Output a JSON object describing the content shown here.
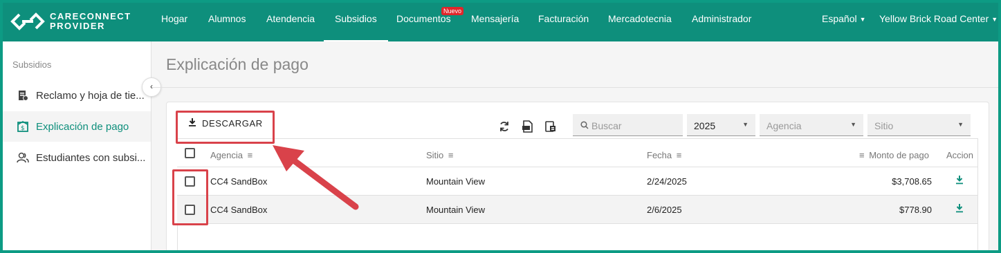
{
  "brand": {
    "line1": "CARECONNECT",
    "line2": "PROVIDER"
  },
  "nav": {
    "items": [
      {
        "label": "Hogar"
      },
      {
        "label": "Alumnos"
      },
      {
        "label": "Atendencia"
      },
      {
        "label": "Subsidios"
      },
      {
        "label": "Documentos"
      },
      {
        "label": "Mensajería"
      },
      {
        "label": "Facturación"
      },
      {
        "label": "Mercadotecnia"
      },
      {
        "label": "Administrador"
      }
    ],
    "badge": "Nuevo",
    "language": "Español",
    "center": "Yellow Brick Road Center"
  },
  "sidebar": {
    "title": "Subsidios",
    "items": [
      {
        "label": "Reclamo y hoja de tie..."
      },
      {
        "label": "Explicación de pago"
      },
      {
        "label": "Estudiantes con subsi..."
      }
    ]
  },
  "main": {
    "title": "Explicación de pago",
    "download_label": "DESCARGAR",
    "search_placeholder": "Buscar",
    "year": "2025",
    "agency_placeholder": "Agencia",
    "site_placeholder": "Sitio"
  },
  "table": {
    "headers": {
      "agency": "Agencia",
      "site": "Sitio",
      "date": "Fecha",
      "amount": "Monto de pago",
      "action": "Accion"
    },
    "rows": [
      {
        "agency": "CC4 SandBox",
        "site": "Mountain View",
        "date": "2/24/2025",
        "amount": "$3,708.65"
      },
      {
        "agency": "CC4 SandBox",
        "site": "Mountain View",
        "date": "2/6/2025",
        "amount": "$778.90"
      }
    ]
  },
  "colors": {
    "brand": "#0e8f7c",
    "annotation": "#d9424a",
    "badge": "#e0262b"
  }
}
